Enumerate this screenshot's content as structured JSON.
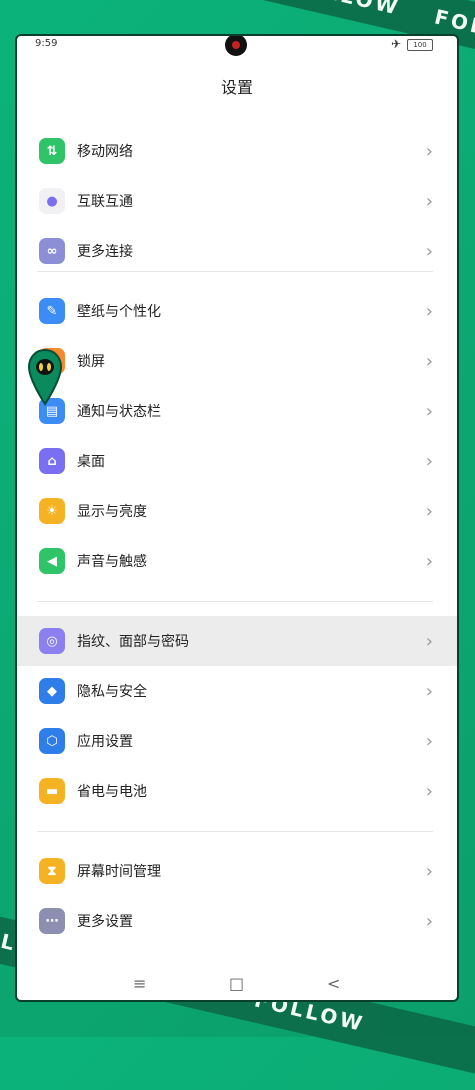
{
  "watermark": {
    "text": "FOLLOW"
  },
  "status_bar": {
    "time": "9:59",
    "battery": "100"
  },
  "header": {
    "title": "设置"
  },
  "groups": [
    {
      "items": [
        {
          "label": "移动网络",
          "color": "#2ec467"
        },
        {
          "label": "互联互通",
          "color": "#f1f1f4"
        },
        {
          "label": "更多连接",
          "color": "#8c8fd6"
        }
      ]
    },
    {
      "items": [
        {
          "label": "壁纸与个性化",
          "color": "#3b8cf4"
        },
        {
          "label": "锁屏",
          "color": "#f58a2e"
        },
        {
          "label": "通知与状态栏",
          "color": "#3b8cf4"
        },
        {
          "label": "桌面",
          "color": "#7a6ff0"
        },
        {
          "label": "显示与亮度",
          "color": "#f5b324"
        },
        {
          "label": "声音与触感",
          "color": "#2ec467"
        }
      ]
    },
    {
      "items": [
        {
          "label": "指纹、面部与密码",
          "color": "#8c7ff0",
          "highlighted": true
        },
        {
          "label": "隐私与安全",
          "color": "#2f7de8"
        },
        {
          "label": "应用设置",
          "color": "#2f7de8"
        },
        {
          "label": "省电与电池",
          "color": "#f5b324"
        }
      ]
    },
    {
      "items": [
        {
          "label": "屏幕时间管理",
          "color": "#f5b324"
        },
        {
          "label": "更多设置",
          "color": "#8c8fb0"
        }
      ]
    }
  ],
  "nav": {
    "menu_icon": "≡",
    "home_icon": "□",
    "back_icon": "<"
  }
}
